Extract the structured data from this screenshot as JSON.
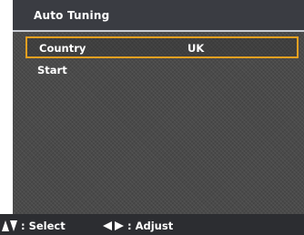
{
  "menu": {
    "title": "Auto Tuning",
    "items": [
      {
        "label": "Country",
        "value": "UK",
        "selected": true
      },
      {
        "label": "Start",
        "value": "",
        "selected": false
      }
    ]
  },
  "footer": {
    "select_text": ": Select",
    "adjust_text": ": Adjust"
  },
  "colors": {
    "highlight_border": "#e8a020",
    "title_bar": "#3a3c42",
    "background": "#4a4a4a"
  },
  "icons": {
    "select": "up-down-arrows-icon",
    "adjust": "left-right-arrows-icon"
  }
}
